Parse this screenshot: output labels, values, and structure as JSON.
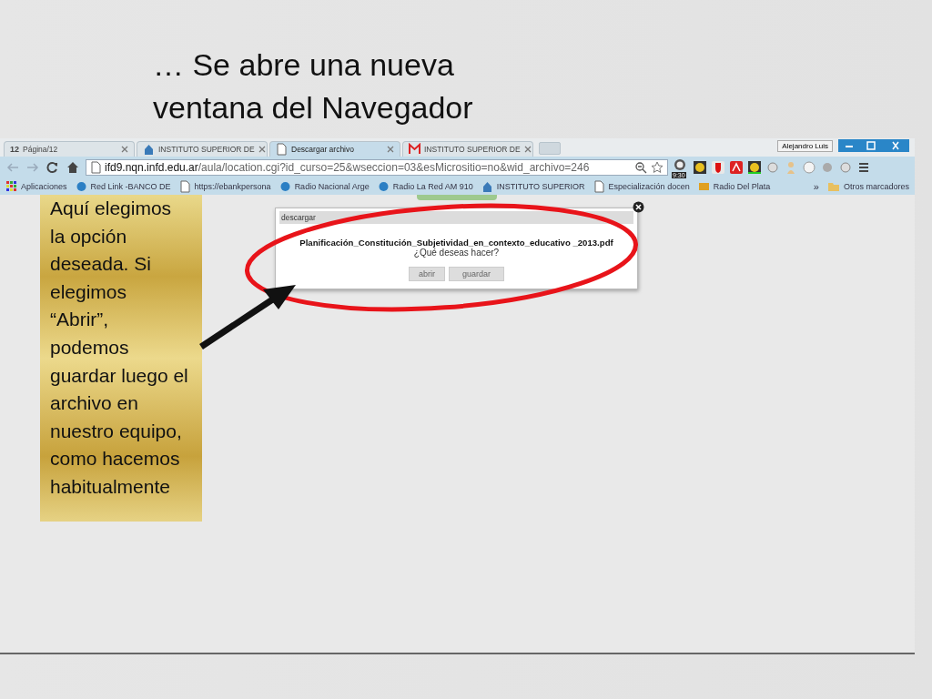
{
  "slide": {
    "title": "… Se abre una nueva ventana del Navegador",
    "callout": "Aquí elegimos la opción deseada. Si elegimos “Abrir”, podemos guardar luego el archivo en nuestro equipo, como hacemos habitualmente"
  },
  "browser": {
    "tabs": [
      {
        "kind": "text",
        "icon_text": "12",
        "label": "Página/12",
        "selected": false
      },
      {
        "kind": "house",
        "label": "INSTITUTO SUPERIOR DE",
        "selected": false
      },
      {
        "kind": "page",
        "label": "Descargar archivo",
        "selected": true
      },
      {
        "kind": "mail",
        "label": "INSTITUTO SUPERIOR DE",
        "selected": false
      }
    ],
    "user": "Alejandro Luis",
    "address": {
      "host": "ifd9.nqn.infd.edu.ar",
      "path": "/aula/location.cgi?id_curso=25&wseccion=03&esMicrositio=no&wid_archivo=246"
    },
    "extension_badge": "9:30",
    "bookmarks": [
      {
        "kind": "grid",
        "label": "Aplicaciones"
      },
      {
        "kind": "circle",
        "label": "Red Link -BANCO DE"
      },
      {
        "kind": "page",
        "label": "https://ebankpersona"
      },
      {
        "kind": "circle",
        "label": "Radio Nacional Arge"
      },
      {
        "kind": "circle",
        "label": "Radio La Red AM 910"
      },
      {
        "kind": "house",
        "label": "INSTITUTO SUPERIOR"
      },
      {
        "kind": "page",
        "label": "Especialización docen"
      },
      {
        "kind": "radio",
        "label": "Radio Del Plata"
      }
    ],
    "more": "»",
    "other_bookmarks": "Otros marcadores",
    "dialog": {
      "title": "descargar",
      "filename": "Planificación_Constitución_Subjetividad_en_contexto_educativo _2013.pdf",
      "question": "¿Qué deseas hacer?",
      "buttons": [
        "abrir",
        "guardar"
      ]
    }
  }
}
